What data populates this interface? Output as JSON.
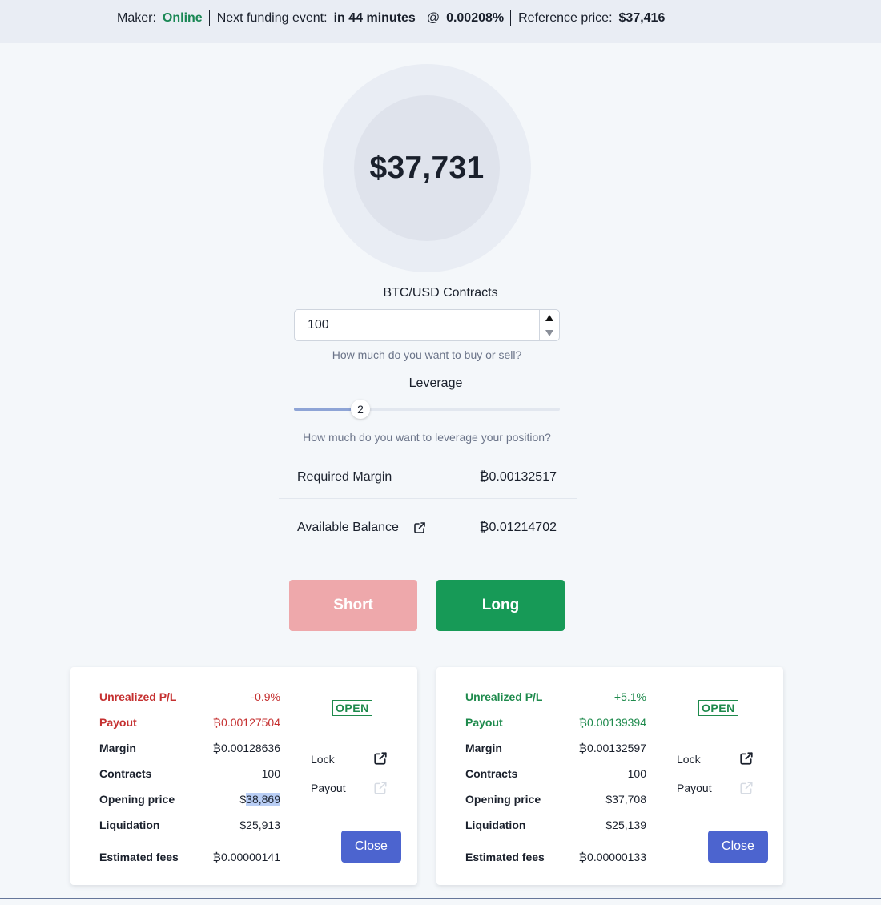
{
  "topbar": {
    "maker_label": "Maker:",
    "maker_status": "Online",
    "funding_label": "Next funding event:",
    "funding_time": "in 44 minutes",
    "at_symbol": "@",
    "funding_rate": "0.00208%",
    "ref_label": "Reference price:",
    "ref_price": "$37,416"
  },
  "ticker": {
    "price": "$37,731"
  },
  "order": {
    "contracts_label": "BTC/USD Contracts",
    "contracts_value": "100",
    "contracts_hint": "How much do you want to buy or sell?",
    "leverage_label": "Leverage",
    "leverage_value": "2",
    "leverage_hint": "How much do you want to leverage your position?",
    "required_margin_label": "Required Margin",
    "required_margin_value": "₿0.00132517",
    "available_balance_label": "Available Balance",
    "available_balance_value": "₿0.01214702",
    "short_label": "Short",
    "long_label": "Long"
  },
  "positions": [
    {
      "pl_label": "Unrealized P/L",
      "pl_value": "-0.9%",
      "pl_color": "red",
      "payout_label": "Payout",
      "payout_value": "₿0.00127504",
      "margin_label": "Margin",
      "margin_value": "₿0.00128636",
      "contracts_label": "Contracts",
      "contracts_value": "100",
      "opening_label": "Opening price",
      "opening_prefix": "$",
      "opening_value": "38,869",
      "liq_label": "Liquidation",
      "liq_value": "$25,913",
      "fees_label": "Estimated fees",
      "fees_value": "₿0.00000141",
      "status": "OPEN",
      "lock_label": "Lock",
      "payout_action_label": "Payout",
      "close_label": "Close"
    },
    {
      "pl_label": "Unrealized P/L",
      "pl_value": "+5.1%",
      "pl_color": "green",
      "payout_label": "Payout",
      "payout_value": "₿0.00139394",
      "margin_label": "Margin",
      "margin_value": "₿0.00132597",
      "contracts_label": "Contracts",
      "contracts_value": "100",
      "opening_label": "Opening price",
      "opening_value": "$37,708",
      "liq_label": "Liquidation",
      "liq_value": "$25,139",
      "fees_label": "Estimated fees",
      "fees_value": "₿0.00000133",
      "status": "OPEN",
      "lock_label": "Lock",
      "payout_action_label": "Payout",
      "close_label": "Close"
    }
  ],
  "colors": {
    "online": "#198754",
    "short": "#eea8ab",
    "long": "#179a57",
    "close": "#4c64cf",
    "loss": "#c53030",
    "gain": "#1e8a4c"
  },
  "icons": [
    "external-link-icon",
    "spin-up-icon",
    "spin-down-icon"
  ]
}
